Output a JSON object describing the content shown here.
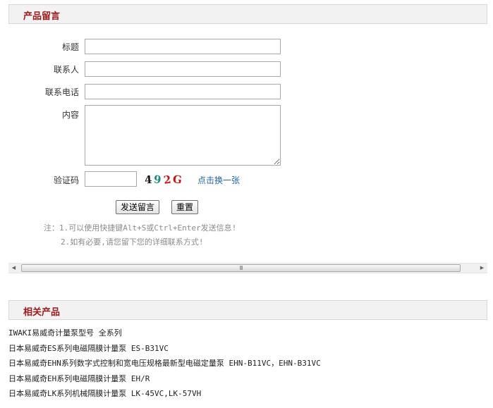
{
  "message_panel": {
    "title": "产品留言",
    "labels": {
      "subject": "标题",
      "contact": "联系人",
      "phone": "联系电话",
      "content": "内容",
      "captcha": "验证码"
    },
    "fields": {
      "subject_value": "",
      "contact_value": "",
      "phone_value": "",
      "content_value": "",
      "captcha_value": ""
    },
    "captcha_chars": [
      {
        "char": "4",
        "color": "#1a1a1a"
      },
      {
        "char": "9",
        "color": "#1a8a7a"
      },
      {
        "char": "2",
        "color": "#cc1111"
      },
      {
        "char": "G",
        "color": "#cc1111"
      }
    ],
    "refresh_link": "点击换一张",
    "submit_label": "发送留言",
    "reset_label": "重置",
    "notes": [
      "注：1.可以使用快捷键Alt+S或Ctrl+Enter发送信息!",
      "2.如有必要,请您留下您的详细联系方式!"
    ]
  },
  "scrollbar": {
    "left_arrow": "◀",
    "right_arrow": "▶",
    "grip": "III"
  },
  "related_panel": {
    "title": "相关产品",
    "items": [
      "IWAKI易威奇计量泵型号 全系列",
      "日本易威奇ES系列电磁隔膜计量泵 ES-B31VC",
      "日本易威奇EHN系列数字式控制和宽电压规格最新型电磁定量泵 EHN-B11VC，EHN-B31VC",
      "日本易威奇EH系列电磁隔膜计量泵 EH/R",
      "日本易威奇LK系列机械隔膜计量泵 LK-45VC,LK-57VH"
    ]
  },
  "colors": {
    "header_title": "#9c1a1a",
    "link": "#2266aa",
    "note": "#8c8c8c"
  }
}
